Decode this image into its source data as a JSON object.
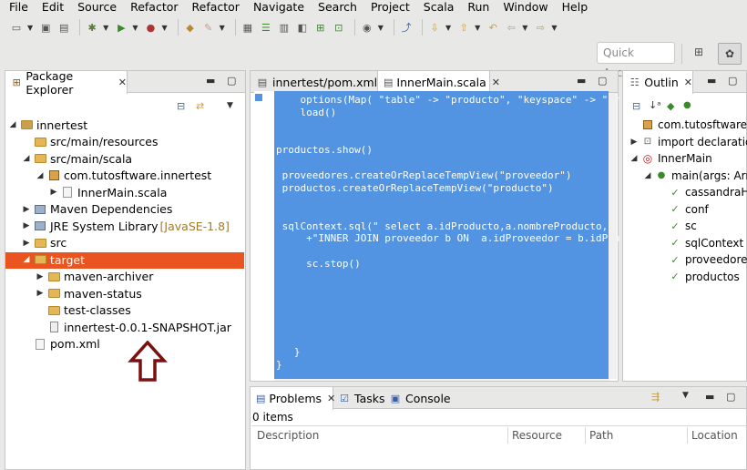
{
  "menu": [
    "File",
    "Edit",
    "Source",
    "Refactor",
    "Refactor",
    "Navigate",
    "Search",
    "Project",
    "Scala",
    "Run",
    "Window",
    "Help"
  ],
  "quick_access": "Quick Access",
  "package_explorer": {
    "tab_label": "Package Explorer",
    "tree": [
      {
        "label": "innertest",
        "depth": 0,
        "twisty": "open",
        "icon": "project-icon"
      },
      {
        "label": "src/main/resources",
        "depth": 1,
        "twisty": "",
        "icon": "source-folder-icon"
      },
      {
        "label": "src/main/scala",
        "depth": 1,
        "twisty": "open",
        "icon": "source-folder-icon"
      },
      {
        "label": "com.tutosftware.innertest",
        "depth": 2,
        "twisty": "open",
        "icon": "package-icon"
      },
      {
        "label": "InnerMain.scala",
        "depth": 3,
        "twisty": "closed",
        "icon": "scala-file-icon"
      },
      {
        "label": "Maven Dependencies",
        "depth": 1,
        "twisty": "closed",
        "icon": "library-icon"
      },
      {
        "label": "JRE System Library",
        "extra": "[JavaSE-1.8]",
        "depth": 1,
        "twisty": "closed",
        "icon": "library-icon"
      },
      {
        "label": "src",
        "depth": 1,
        "twisty": "closed",
        "icon": "folder-icon"
      },
      {
        "label": "target",
        "depth": 1,
        "twisty": "open",
        "icon": "folder-icon",
        "selected": true
      },
      {
        "label": "maven-archiver",
        "depth": 2,
        "twisty": "closed",
        "icon": "folder-icon"
      },
      {
        "label": "maven-status",
        "depth": 2,
        "twisty": "closed",
        "icon": "folder-icon"
      },
      {
        "label": "test-classes",
        "depth": 2,
        "twisty": "",
        "icon": "folder-icon"
      },
      {
        "label": "innertest-0.0.1-SNAPSHOT.jar",
        "depth": 2,
        "twisty": "",
        "icon": "jar-icon"
      },
      {
        "label": "pom.xml",
        "depth": 1,
        "twisty": "",
        "icon": "xml-file-icon"
      }
    ]
  },
  "editor": {
    "tabs": [
      {
        "label": "innertest/pom.xml",
        "active": false
      },
      {
        "label": "InnerMain.scala",
        "active": true
      }
    ],
    "lines": [
      "    options(Map( \"table\" -> \"producto\", \"keyspace\" -> \"pr",
      "    load()",
      "",
      "",
      "productos.show()",
      "",
      " proveedores.createOrReplaceTempView(\"proveedor\")",
      " productos.createOrReplaceTempView(\"producto\")",
      "",
      "",
      " sqlContext.sql(\" select a.idProducto,a.nombreProducto,b.",
      "     +\"INNER JOIN proveedor b ON  a.idProveedor = b.idPro",
      "",
      "     sc.stop()",
      "",
      "",
      "",
      "",
      "",
      "",
      "   }",
      "}"
    ]
  },
  "outline": {
    "tab_label": "Outlin",
    "items": [
      {
        "label": "com.tutosftware.in",
        "depth": 0,
        "icon": "package-icon"
      },
      {
        "label": "import declaration",
        "depth": 0,
        "icon": "import-icon",
        "twisty": "closed"
      },
      {
        "label": "InnerMain",
        "depth": 0,
        "icon": "object-icon",
        "twisty": "open"
      },
      {
        "label": "main(args: Array",
        "depth": 1,
        "icon": "method-icon",
        "twisty": "open"
      },
      {
        "label": "cassandraHos",
        "depth": 2,
        "icon": "val-icon"
      },
      {
        "label": "conf",
        "depth": 2,
        "icon": "val-icon"
      },
      {
        "label": "sc",
        "depth": 2,
        "icon": "val-icon"
      },
      {
        "label": "sqlContext",
        "depth": 2,
        "icon": "val-icon"
      },
      {
        "label": "proveedores",
        "depth": 2,
        "icon": "val-icon"
      },
      {
        "label": "productos",
        "depth": 2,
        "icon": "val-icon"
      }
    ]
  },
  "bottom": {
    "tabs": [
      "Problems",
      "Tasks",
      "Console"
    ],
    "summary": "0 items",
    "columns": [
      "Description",
      "Resource",
      "Path",
      "Location"
    ]
  },
  "colors": {
    "selection": "#e95420",
    "editor_selection": "#5294e2",
    "arrow": "#7a1010"
  }
}
